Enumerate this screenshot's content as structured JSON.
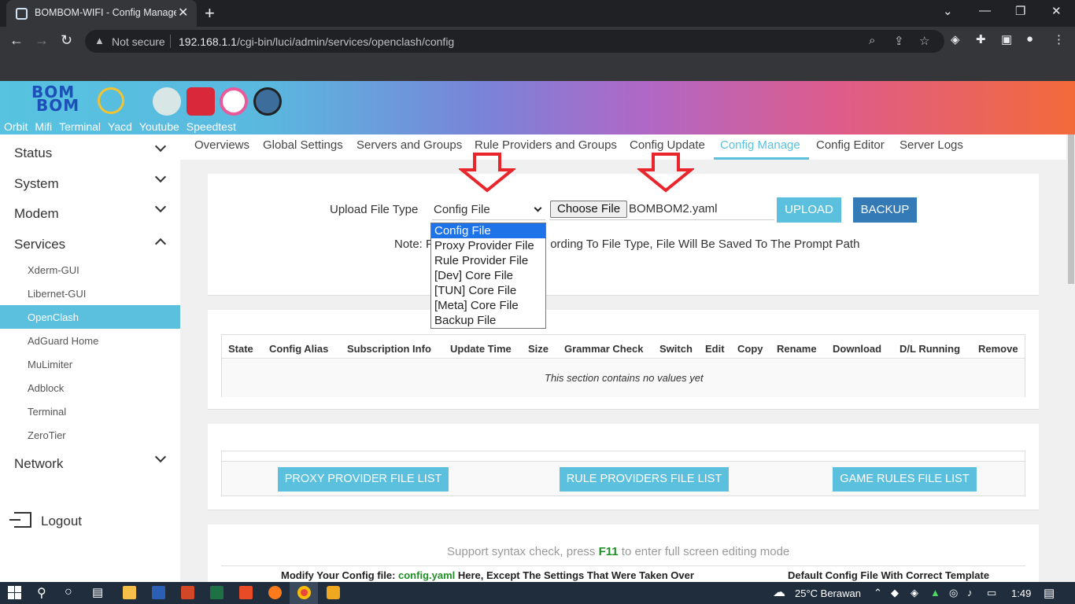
{
  "browser": {
    "tab_title": "BOMBOM-WIFI - Config Manage",
    "not_secure": "Not secure",
    "url_host": "192.168.1.1",
    "url_path": "/cgi-bin/luci/admin/services/openclash/config"
  },
  "site": {
    "logo_line1": "BOM",
    "logo_line2": "BOM",
    "top_links": [
      "Orbit",
      "Mifi",
      "Terminal",
      "Yacd",
      "Youtube",
      "Speedtest"
    ]
  },
  "sidebar": {
    "items": [
      {
        "label": "Status"
      },
      {
        "label": "System"
      },
      {
        "label": "Modem"
      },
      {
        "label": "Services"
      },
      {
        "label": "Network"
      }
    ],
    "services_sub": [
      "Xderm-GUI",
      "Libernet-GUI",
      "OpenClash",
      "AdGuard Home",
      "MuLimiter",
      "Adblock",
      "Terminal",
      "ZeroTier"
    ],
    "logout": "Logout"
  },
  "tabs": [
    "Overviews",
    "Global Settings",
    "Servers and Groups",
    "Rule Providers and Groups",
    "Config Update",
    "Config Manage",
    "Config Editor",
    "Server Logs"
  ],
  "upload": {
    "label": "Upload File Type",
    "selected": "Config File",
    "choose_btn": "Choose File",
    "file_name": "BOMBOM2.yaml",
    "upload_btn": "UPLOAD",
    "backup_btn": "BACKUP",
    "note_prefix": "Note: F",
    "note_rest": "ording To File Type, File Will Be Saved To The Prompt Path",
    "options": [
      "Config File",
      "Proxy Provider File",
      "Rule Provider File",
      "[Dev] Core File",
      "[TUN] Core File",
      "[Meta] Core File",
      "Backup File"
    ]
  },
  "config_table": {
    "headers": [
      "State",
      "Config Alias",
      "Subscription Info",
      "Update Time",
      "Size",
      "Grammar Check",
      "Switch",
      "Edit",
      "Copy",
      "Rename",
      "Download",
      "D/L Running",
      "Remove"
    ],
    "empty": "This section contains no values yet"
  },
  "file_lists": [
    "PROXY PROVIDER FILE LIST",
    "RULE PROVIDERS FILE LIST",
    "GAME RULES FILE LIST"
  ],
  "editor": {
    "syntax_pre": "Support syntax check, press ",
    "syntax_key": "F11",
    "syntax_post": " to enter full screen editing mode",
    "col1_pre": "Modify Your Config file: ",
    "col1_file": "config.yaml",
    "col1_post": " Here, Except The Settings That Were Taken Over",
    "col2": "Default Config File With Correct Template"
  },
  "taskbar": {
    "weather": "25°C  Berawan",
    "time": "1:49"
  },
  "colors": {
    "accent": "#5bc0de",
    "primary": "#337ab7",
    "arrow": "#e8262b"
  }
}
